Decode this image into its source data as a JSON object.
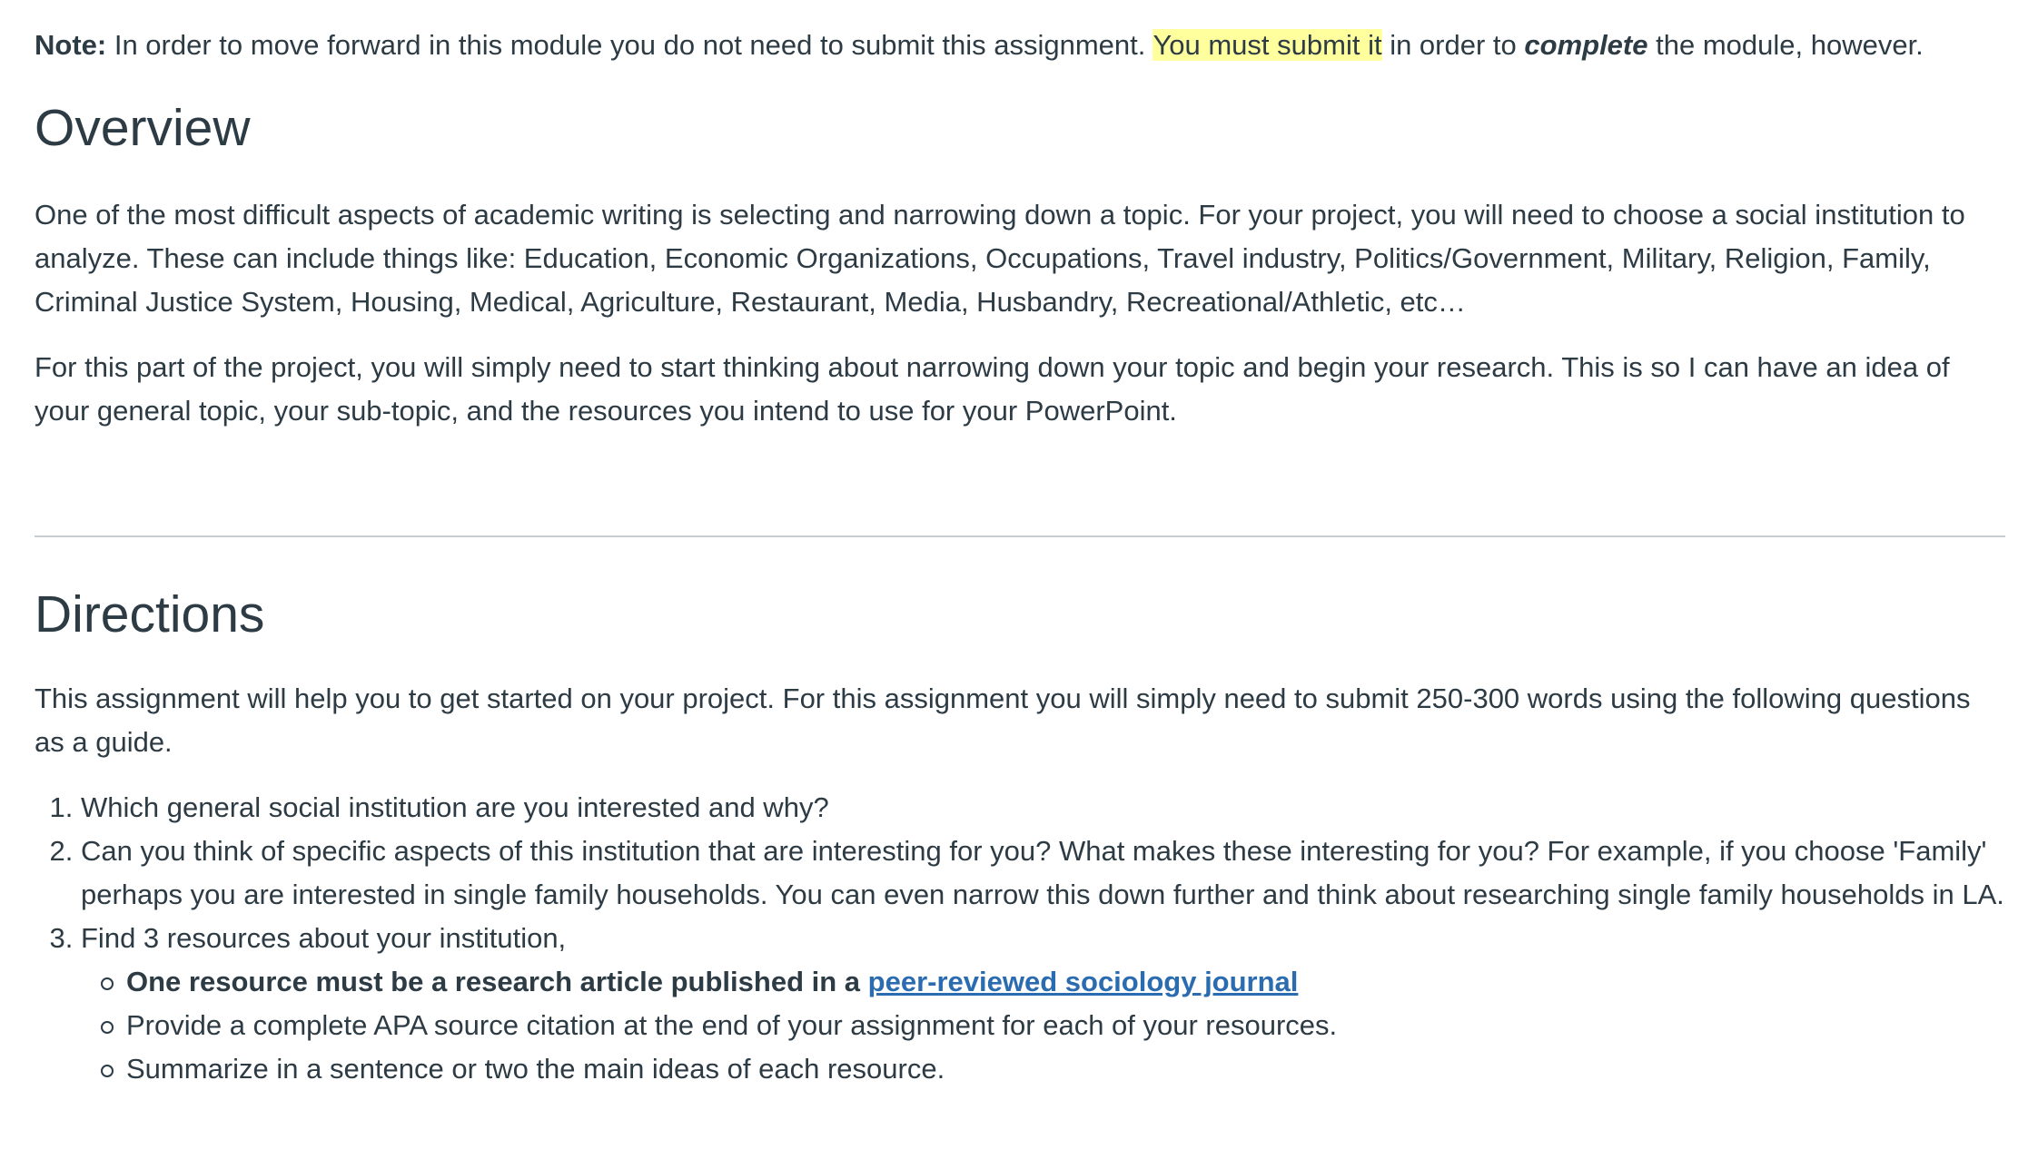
{
  "note": {
    "label": "Note:",
    "text1": " In order to move forward in this module you do not need to submit this assignment. ",
    "highlight": "You must submit it",
    "text2": " in order to ",
    "emphasis": "complete",
    "text3": " the module, however."
  },
  "overview": {
    "heading": "Overview",
    "paragraph1": "One of the most difficult aspects of academic writing is selecting and narrowing down a topic. For your project, you will need to choose a social institution to analyze. These can include things like: Education, Economic Organizations, Occupations, Travel industry, Politics/Government, Military, Religion, Family, Criminal Justice System, Housing, Medical, Agriculture, Restaurant, Media, Husbandry, Recreational/Athletic, etc…",
    "paragraph2": "For this part of the project, you will simply need to start thinking about narrowing down your topic and begin your research. This is so I can have an idea of your general topic, your sub-topic, and the resources you intend to use for your PowerPoint."
  },
  "directions": {
    "heading": "Directions",
    "intro": "This assignment will help you to get started on your project. For this assignment you will simply need to submit 250-300 words using the following questions as a guide.",
    "items": [
      "Which general social institution are you interested and why?",
      "Can you think of specific aspects of this institution that are interesting for you? What makes these interesting for you? For example, if you choose 'Family' perhaps you are interested in single family households. You can even narrow this down further and think about researching single family households in LA.",
      "Find 3 resources about your institution,"
    ],
    "subitems": {
      "required_text": "One resource must be a research article published in a ",
      "link_text": "peer-reviewed sociology journal",
      "citation": "Provide a complete APA source citation at the end of your assignment for each of your resources.",
      "summary": "Summarize in a sentence or two the main ideas of each resource."
    }
  },
  "colors": {
    "text": "#2d3b45",
    "highlight": "#ffff9e",
    "link": "#2b6cb0",
    "divider": "#c7cdd1"
  }
}
